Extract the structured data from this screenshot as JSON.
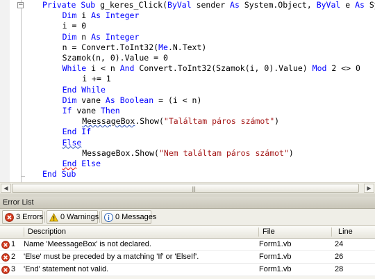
{
  "editor": {
    "lines": [
      {
        "indent": 0,
        "parts": [
          {
            "t": "Private Sub ",
            "c": "kw"
          },
          {
            "t": "g_keres_Click(",
            "c": ""
          },
          {
            "t": "ByVal",
            "c": "kw"
          },
          {
            "t": " sender ",
            "c": ""
          },
          {
            "t": "As",
            "c": "kw"
          },
          {
            "t": " System.Object, ",
            "c": ""
          },
          {
            "t": "ByVal",
            "c": "kw"
          },
          {
            "t": " e ",
            "c": ""
          },
          {
            "t": "As",
            "c": "kw"
          },
          {
            "t": " System.EventArgs) Handles g_keres.Click",
            "c": ""
          }
        ]
      },
      {
        "indent": 1,
        "parts": [
          {
            "t": "Dim",
            "c": "kw"
          },
          {
            "t": " i ",
            "c": ""
          },
          {
            "t": "As Integer",
            "c": "kw"
          }
        ]
      },
      {
        "indent": 1,
        "parts": [
          {
            "t": "i = 0",
            "c": ""
          }
        ]
      },
      {
        "indent": 1,
        "parts": [
          {
            "t": "Dim",
            "c": "kw"
          },
          {
            "t": " n ",
            "c": ""
          },
          {
            "t": "As Integer",
            "c": "kw"
          }
        ]
      },
      {
        "indent": 1,
        "parts": [
          {
            "t": "n = Convert.ToInt32(",
            "c": ""
          },
          {
            "t": "Me",
            "c": "kw"
          },
          {
            "t": ".N.Text)",
            "c": ""
          }
        ]
      },
      {
        "indent": 1,
        "parts": [
          {
            "t": "Szamok(n, 0).Value = 0",
            "c": ""
          }
        ]
      },
      {
        "indent": 1,
        "parts": [
          {
            "t": "While",
            "c": "kw"
          },
          {
            "t": " i < n ",
            "c": ""
          },
          {
            "t": "And",
            "c": "kw"
          },
          {
            "t": " Convert.ToInt32(Szamok(i, 0).Value) ",
            "c": ""
          },
          {
            "t": "Mod",
            "c": "kw"
          },
          {
            "t": " 2 <> 0",
            "c": ""
          }
        ]
      },
      {
        "indent": 2,
        "parts": [
          {
            "t": "i += 1",
            "c": ""
          }
        ]
      },
      {
        "indent": 1,
        "parts": [
          {
            "t": "End While",
            "c": "kw"
          }
        ]
      },
      {
        "indent": 1,
        "parts": [
          {
            "t": "Dim",
            "c": "kw"
          },
          {
            "t": " vane ",
            "c": ""
          },
          {
            "t": "As Boolean",
            "c": "kw"
          },
          {
            "t": " = (i < n)",
            "c": ""
          }
        ]
      },
      {
        "indent": 1,
        "parts": [
          {
            "t": "If",
            "c": "kw"
          },
          {
            "t": " vane ",
            "c": ""
          },
          {
            "t": "Then",
            "c": "kw"
          }
        ]
      },
      {
        "indent": 2,
        "parts": [
          {
            "t": "MeessageBox",
            "c": "squiggle"
          },
          {
            "t": ".Show(",
            "c": ""
          },
          {
            "t": "\"Találtam páros számot\"",
            "c": "str"
          },
          {
            "t": ")",
            "c": ""
          }
        ]
      },
      {
        "indent": 1,
        "parts": [
          {
            "t": "End If",
            "c": "kw"
          }
        ]
      },
      {
        "indent": 1,
        "parts": [
          {
            "t": "Else",
            "c": "kw squiggle"
          }
        ]
      },
      {
        "indent": 2,
        "parts": [
          {
            "t": "MessageBox.Show(",
            "c": ""
          },
          {
            "t": "\"Nem találtam páros számot\"",
            "c": "str"
          },
          {
            "t": ")",
            "c": ""
          }
        ]
      },
      {
        "indent": 1,
        "parts": [
          {
            "t": "End",
            "c": "kw squiggle-red"
          },
          {
            "t": " Else",
            "c": "kw"
          }
        ]
      },
      {
        "indent": 0,
        "parts": [
          {
            "t": "End Sub",
            "c": "kw"
          }
        ]
      }
    ]
  },
  "error_list": {
    "title": "Error List",
    "filters": {
      "errors_label": "3 Errors",
      "warnings_label": "0 Warnings",
      "messages_label": "0 Messages"
    },
    "columns": {
      "description": "Description",
      "file": "File",
      "line": "Line"
    },
    "rows": [
      {
        "num": "1",
        "description": "Name 'MeessageBox' is not declared.",
        "file": "Form1.vb",
        "line": "24"
      },
      {
        "num": "2",
        "description": "'Else' must be preceded by a matching 'If' or 'ElseIf'.",
        "file": "Form1.vb",
        "line": "26"
      },
      {
        "num": "3",
        "description": "'End' statement not valid.",
        "file": "Form1.vb",
        "line": "28"
      }
    ]
  },
  "colors": {
    "keyword": "#0000ff",
    "string": "#a31515",
    "error_icon": "#d23a1e",
    "warning_icon": "#f2c40e",
    "info_icon": "#2a62b8"
  }
}
